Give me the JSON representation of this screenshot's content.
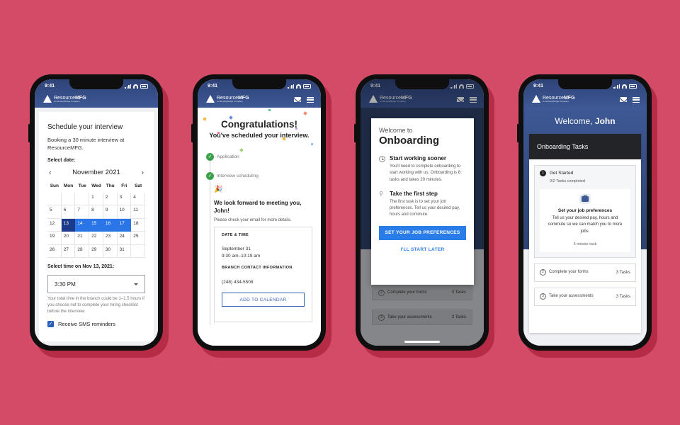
{
  "status": {
    "time": "9:41"
  },
  "brand": {
    "name_light": "Resource",
    "name_bold": "MFG",
    "sub": "An EmployBridge Company"
  },
  "phone1": {
    "title": "Schedule your interview",
    "booking": "Booking a 30 minute interview at ResourceMFG.",
    "select_date_label": "Select date:",
    "month": "November 2021",
    "weekdays": [
      "Sun",
      "Mon",
      "Tue",
      "Wed",
      "Thu",
      "Fri",
      "Sat"
    ],
    "days": [
      "",
      "",
      "",
      "1",
      "2",
      "3",
      "4",
      "5",
      "6",
      "7",
      "8",
      "9",
      "10",
      "11",
      "12",
      "13",
      "14",
      "15",
      "16",
      "17",
      "18",
      "19",
      "20",
      "21",
      "22",
      "23",
      "24",
      "25",
      "26",
      "27",
      "28",
      "29",
      "30",
      "31",
      ""
    ],
    "selected_day": "13",
    "highlighted_days": [
      "14",
      "15",
      "16",
      "17"
    ],
    "select_time_label": "Select time on Nov 13, 2021:",
    "time_value": "3:30 PM",
    "hint": "Your total time in the branch could be 1–1.5 hours if you choose not to complete your hiring checklist before the interview.",
    "sms_label": "Receive SMS reminders"
  },
  "phone2": {
    "congrats": "Congratulations!",
    "scheduled": "You've scheduled your interview.",
    "steps": [
      "Application",
      "Interview scheduling"
    ],
    "party_icon": "🎉",
    "forward": "We look forward to meeting you, John!",
    "check_email": "Please check your email for more details.",
    "date_time_label": "DATE & TIME",
    "date": "September 31",
    "time": "9:30 am–10:19 am",
    "branch_label": "BRANCH CONTACT INFORMATION",
    "phone": "(248) 434-5508",
    "calendar_button": "ADD TO CALENDAR"
  },
  "phone3": {
    "welcome_to": "Welcome to",
    "title": "Onboarding",
    "item1_title": "Start working sooner",
    "item1_text": "You'll need to complete onboarding to start working with us. Onboarding is 8 tasks and takes 20 minutes.",
    "item2_title": "Take the first step",
    "item2_text": "The first task is to set your job preferences. Tell us your desired pay, hours and commute.",
    "primary_button": "SET YOUR JOB PREFERENCES",
    "secondary_button": "I'LL START LATER",
    "bg_tasks": [
      {
        "num": "2",
        "label": "Complete your forms",
        "count": "3 Tasks"
      },
      {
        "num": "3",
        "label": "Take your assessments",
        "count": "3 Tasks"
      }
    ]
  },
  "phone4": {
    "welcome": "Welcome,",
    "name": "John",
    "panel_title": "Onboarding Tasks",
    "group_num": "1",
    "group_title": "Get Started",
    "group_sub": "0/2 Tasks completed",
    "card_title": "Set your job preferences",
    "card_text": "Tell us your desired pay, hours and commute so we can match you to more jobs.",
    "card_time": "5 minute task",
    "tasks": [
      {
        "num": "2",
        "label": "Complete your forms",
        "count": "3 Tasks"
      },
      {
        "num": "3",
        "label": "Take your assessments",
        "count": "3 Tasks"
      }
    ]
  }
}
